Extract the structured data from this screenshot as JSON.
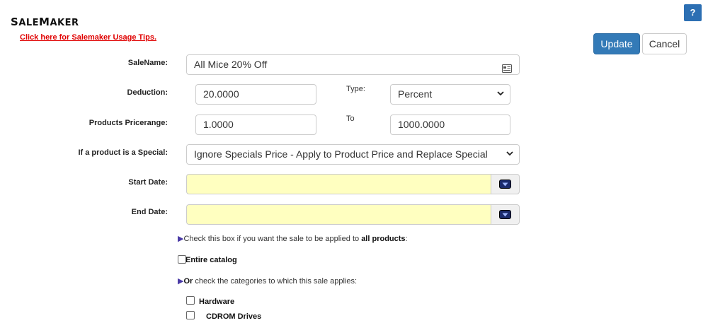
{
  "header": {
    "title_first_letter": "S",
    "title_rest": "ALE",
    "title_m": "M",
    "title_rest2": "AKER",
    "tips_link": "Click here for Salemaker Usage Tips.",
    "help_label": "?"
  },
  "toolbar": {
    "update_label": "Update",
    "cancel_label": "Cancel"
  },
  "form": {
    "sale_name": {
      "label": "SaleName:",
      "value": "All Mice 20% Off"
    },
    "deduction": {
      "label": "Deduction:",
      "value": "20.0000"
    },
    "type": {
      "label": "Type:",
      "selected": "Percent"
    },
    "pricerange": {
      "label": "Products Pricerange:",
      "from": "1.0000",
      "to_label": "To",
      "to": "1000.0000"
    },
    "special": {
      "label": "If a product is a Special:",
      "selected": "Ignore Specials Price - Apply to Product Price and Replace Special"
    },
    "start_date": {
      "label": "Start Date:",
      "value": ""
    },
    "end_date": {
      "label": "End Date:",
      "value": ""
    }
  },
  "scope": {
    "all_note_prefix": "Check this box if you want the sale to be applied to ",
    "all_note_bold": "all products",
    "all_note_suffix": ":",
    "entire_catalog_label": "Entire catalog",
    "or_bold": "Or",
    "categories_note": " check the categories to which this sale applies:",
    "categories": [
      {
        "label": "Hardware",
        "checked": false
      },
      {
        "label": "CDROM Drives",
        "checked": false
      }
    ]
  },
  "colors": {
    "primary": "#337ab7",
    "link_red": "#e00000",
    "date_bg": "#ffffc0"
  },
  "icons": {
    "sale_name_field": "card-icon",
    "date_picker": "calendar-dropdown-icon",
    "bullet": "triangle-right-icon",
    "select": "chevron-down-icon"
  }
}
